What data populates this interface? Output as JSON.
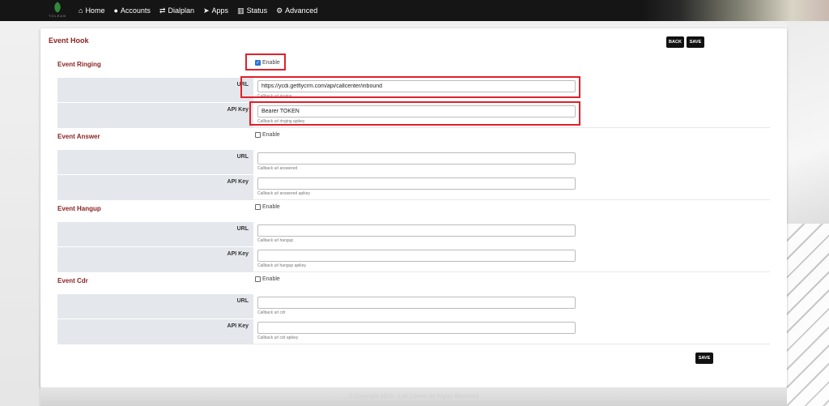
{
  "nav": {
    "logo_text": "TOLEAN",
    "items": [
      {
        "label": "Home",
        "icon": "home-icon",
        "glyph": "⌂"
      },
      {
        "label": "Accounts",
        "icon": "user-icon",
        "glyph": "👤"
      },
      {
        "label": "Dialplan",
        "icon": "exchange-icon",
        "glyph": "⇄"
      },
      {
        "label": "Apps",
        "icon": "send-icon",
        "glyph": "➤"
      },
      {
        "label": "Status",
        "icon": "chart-icon",
        "glyph": "▥"
      },
      {
        "label": "Advanced",
        "icon": "gear-icon",
        "glyph": "⚙"
      }
    ]
  },
  "page": {
    "title": "Event Hook",
    "back_label": "BACK",
    "save_label": "SAVE",
    "save_bottom_label": "SAVE",
    "enable_label": "Enable",
    "url_label": "URL",
    "apikey_label": "API Key",
    "footer": "© Copyright 2023 · Call Center. All Rights Reserved"
  },
  "sections": [
    {
      "title": "Event Ringing",
      "enabled": true,
      "url_value": "https://ycdi.getflycrm.com/api/callcenter/inbound",
      "url_help": "Callback url ringing",
      "apikey_value": "Bearer TOKEN",
      "apikey_help": "Callback url ringing apikey"
    },
    {
      "title": "Event Answer",
      "enabled": false,
      "url_value": "",
      "url_help": "Callback url answered",
      "apikey_value": "",
      "apikey_help": "Callback url answered apikey"
    },
    {
      "title": "Event Hangup",
      "enabled": false,
      "url_value": "",
      "url_help": "Callback url hangup",
      "apikey_value": "",
      "apikey_help": "Callback url hangup apikey"
    },
    {
      "title": "Event Cdr",
      "enabled": false,
      "url_value": "",
      "url_help": "Callback url cdr",
      "apikey_value": "",
      "apikey_help": "Callback url cdr apikey"
    }
  ],
  "colors": {
    "accent_title": "#8b1f1f",
    "highlight": "#e0212b",
    "checkbox": "#2d6fd6"
  }
}
